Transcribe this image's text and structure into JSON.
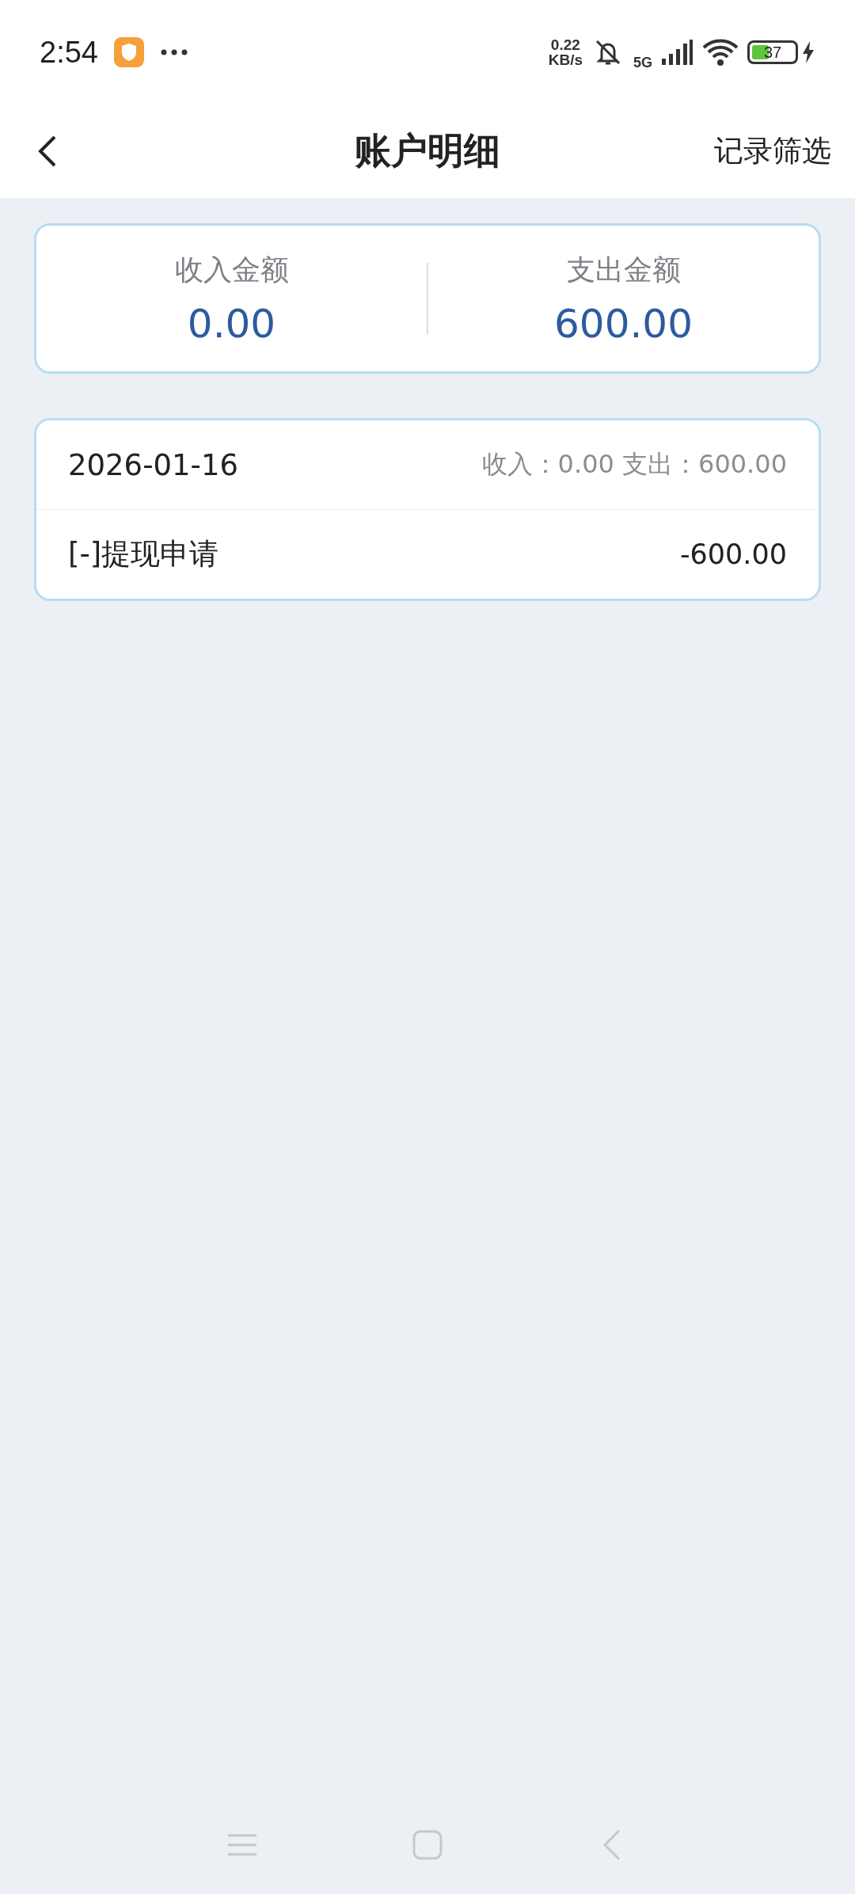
{
  "status_bar": {
    "time": "2:54",
    "speed_value": "0.22",
    "speed_unit": "KB/s",
    "network": "5G",
    "battery": "37"
  },
  "header": {
    "title": "账户明细",
    "action": "记录筛选"
  },
  "summary": [
    {
      "label": "收入金额",
      "amount": "0.00"
    },
    {
      "label": "支出金额",
      "amount": "600.00"
    }
  ],
  "days": [
    {
      "date": "2026-01-16",
      "totals": "收入：0.00 支出：600.00",
      "records": [
        {
          "name": "[-]提现申请",
          "amount": "-600.00"
        }
      ]
    }
  ]
}
